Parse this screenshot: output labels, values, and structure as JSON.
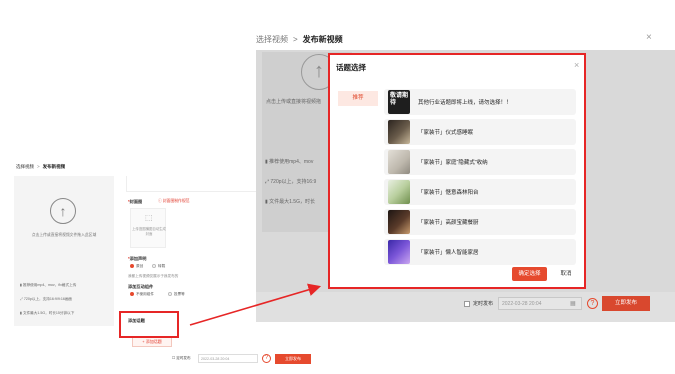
{
  "breadcrumb": {
    "parent": "选择视频",
    "separator": ">",
    "current": "发布新视频"
  },
  "upload": {
    "hint": "点击上传或直接将视频文件拖入此区域",
    "hint_short": "点击上传或直接将视频拖",
    "spec_format": "推荐使用mp4、mov、flv格式上传",
    "spec_format_short": "推荐使用mp4、mov",
    "spec_resolution": "720p以上，支持16:9/9:16画面",
    "spec_resolution_short": "720p以上，支持16:9",
    "spec_size": "文件最大1.5G，时长15分钟以下",
    "spec_size_short": "文件最大1.5G，时长"
  },
  "form": {
    "cover_label": "封面图",
    "cover_hint": "封面图制作规范",
    "cover_upload_text": "上传竖图横图自动生成封面",
    "declaration_label": "添加声明",
    "declaration_options": [
      "原创",
      "转载"
    ],
    "declaration_note": "我都上传视频仅展示于我发布的",
    "interaction_label": "添加互动组件",
    "interaction_options": [
      "不使用组件",
      "投票等"
    ],
    "topic_label": "添加话题",
    "topic_button": "+ 添加话题"
  },
  "footer": {
    "schedule_label": "定时发布",
    "schedule_date": "2022-03-28 20:04",
    "help_icon": "?",
    "publish_button": "立即发布"
  },
  "modal": {
    "title": "话题选择",
    "close_icon": "×",
    "tab_recommend": "推荐",
    "topics": [
      {
        "thumb_text": "敬请期待",
        "text": "其他行业话题即将上线，请勿选择！！"
      },
      {
        "thumb_text": "",
        "text": "「家装节」仪式感睡眠"
      },
      {
        "thumb_text": "",
        "text": "「家装节」家庭“隐藏式”收纳"
      },
      {
        "thumb_text": "",
        "text": "「家装节」惬意森林阳台"
      },
      {
        "thumb_text": "",
        "text": "「家装节」高颜宝藏餐厨"
      },
      {
        "thumb_text": "",
        "text": "「家装节」懒人智能家居"
      }
    ],
    "confirm_button": "确定选择",
    "cancel_button": "取消"
  },
  "colors": {
    "accent": "#e64a2e",
    "highlight": "#e62626",
    "overlay": "#d9d9d9",
    "tab_bg": "#fde8e2"
  },
  "icons": {
    "upload": "up-arrow-circle-icon",
    "close": "close-icon",
    "help": "question-circle-icon",
    "calendar": "calendar-icon"
  }
}
